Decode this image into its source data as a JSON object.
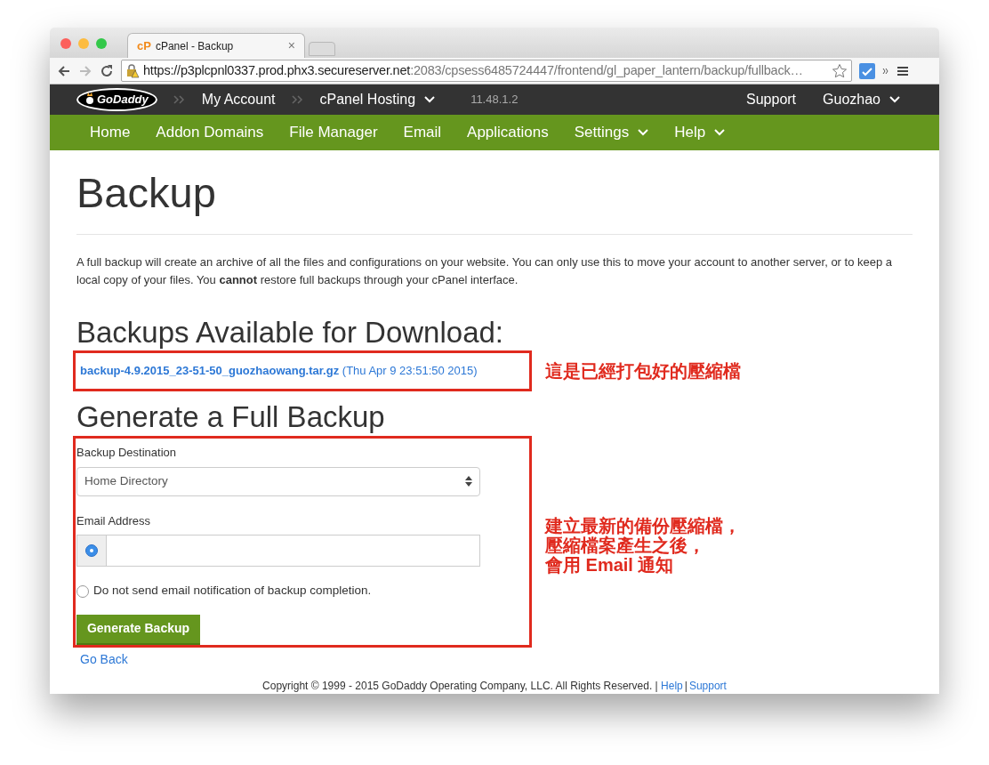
{
  "browser": {
    "tab": {
      "title": "cPanel - Backup",
      "favicon": "cP",
      "close": "×"
    },
    "url_host": "https://p3plcpnl0337.prod.phx3.secureserver.net",
    "url_path": ":2083/cpsess6485724447/frontend/gl_paper_lantern/backup/fullback…"
  },
  "top_nav": {
    "logo": "GoDaddy",
    "breadcrumbs": [
      {
        "label": "My Account",
        "dropdown": false
      },
      {
        "label": "cPanel Hosting",
        "dropdown": true
      }
    ],
    "version": "11.48.1.2",
    "right": [
      {
        "label": "Support",
        "dropdown": false
      },
      {
        "label": "Guozhao",
        "dropdown": true
      }
    ]
  },
  "main_nav": [
    {
      "label": "Home",
      "dropdown": false
    },
    {
      "label": "Addon Domains",
      "dropdown": false
    },
    {
      "label": "File Manager",
      "dropdown": false
    },
    {
      "label": "Email",
      "dropdown": false
    },
    {
      "label": "Applications",
      "dropdown": false
    },
    {
      "label": "Settings",
      "dropdown": true
    },
    {
      "label": "Help",
      "dropdown": true
    }
  ],
  "page": {
    "title": "Backup",
    "intro": "A full backup will create an archive of all the files and configurations on your website. You can only use this to move your account to another server, or to keep a local copy of your files. You **cannot** restore full backups through your cPanel interface.",
    "downloads_heading": "Backups Available for Download:",
    "downloads": [
      {
        "file": "backup-4.9.2015_23-51-50_guozhaowang.tar.gz",
        "date": "(Thu Apr 9 23:51:50 2015)"
      }
    ],
    "generate_heading": "Generate a Full Backup",
    "form": {
      "destination_label": "Backup Destination",
      "destination_value": "Home Directory",
      "email_label": "Email Address",
      "options": [
        {
          "kind": "email",
          "selected": true
        },
        {
          "kind": "none",
          "label": "Do not send email notification of backup completion.",
          "selected": false
        }
      ],
      "button": "Generate Backup"
    },
    "go_back": "Go Back",
    "footer": {
      "text": "Copyright © 1999 - 2015 GoDaddy Operating Company, LLC. All Rights Reserved. |",
      "links": [
        "Help",
        "Support"
      ],
      "separator": "|"
    }
  },
  "annotations": [
    {
      "lines": [
        "這是已經打包好的壓縮檔"
      ]
    },
    {
      "lines": [
        "建立最新的備份壓縮檔，",
        "壓縮檔案產生之後，",
        "會用 Email 通知"
      ]
    }
  ]
}
